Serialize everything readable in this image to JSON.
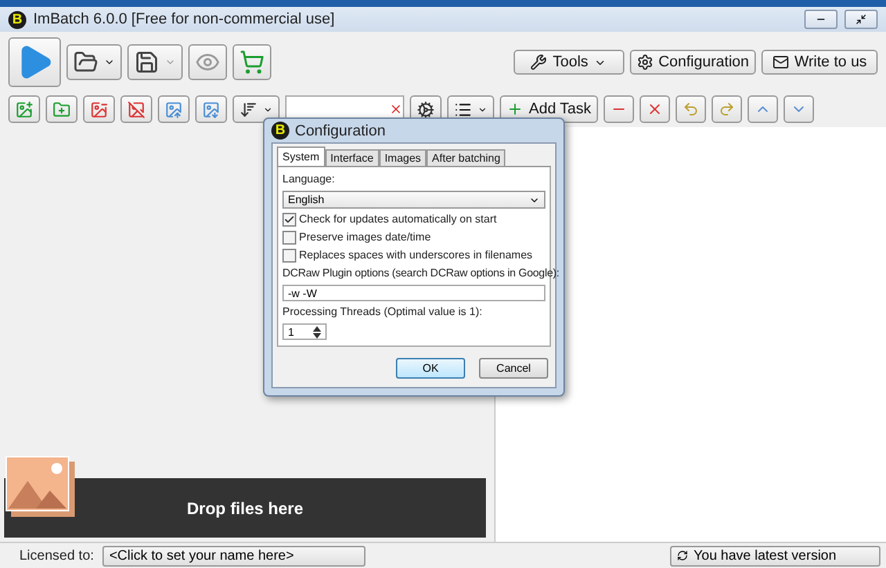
{
  "window": {
    "logo": "B",
    "title": "ImBatch 6.0.0 [Free for non-commercial use]"
  },
  "toolbar": {
    "buttons": [
      {
        "label": "Tools",
        "kind": "dropdown"
      },
      {
        "label": "Configuration",
        "kind": "plain"
      },
      {
        "label": "Write to us",
        "kind": "plain"
      }
    ]
  },
  "task_toolbar": {
    "add_task": "Add Task"
  },
  "drop_zone": {
    "label": "Drop files here"
  },
  "dialog": {
    "logo": "B",
    "title": "Configuration",
    "tabs": [
      {
        "label": "System",
        "selected": true
      },
      {
        "label": "Interface",
        "selected": false
      },
      {
        "label": "Images",
        "selected": false
      },
      {
        "label": "After batching",
        "selected": false
      }
    ],
    "language_label": "Language:",
    "language": "English",
    "checkboxes": [
      {
        "label": "Check for updates automatically on start",
        "checked": true
      },
      {
        "label": "Preserve images date/time",
        "checked": false
      },
      {
        "label": "Replaces spaces with underscores in filenames",
        "checked": false
      }
    ],
    "dcraw_label": "DCRaw Plugin options (search DCRaw options in Google):",
    "dcraw_value": "-w -W",
    "threads_label": "Processing Threads (Optimal value is 1):",
    "threads_value": "1",
    "buttons": [
      {
        "label": "OK",
        "kind": "default"
      },
      {
        "label": "Cancel",
        "kind": "plain"
      }
    ]
  },
  "status_bar": {
    "licensed_label": "Licensed to:",
    "name_field": "<Click to set your name here>",
    "version": "You have latest version"
  }
}
